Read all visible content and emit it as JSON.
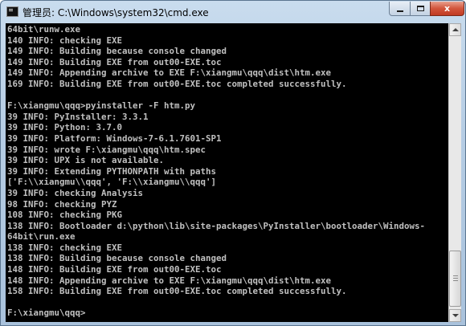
{
  "window": {
    "title": "管理员: C:\\Windows\\system32\\cmd.exe",
    "icon": "cmd-icon",
    "close_label": "x"
  },
  "console": {
    "lines": [
      "64bit\\runw.exe",
      "140 INFO: checking EXE",
      "149 INFO: Building because console changed",
      "149 INFO: Building EXE from out00-EXE.toc",
      "149 INFO: Appending archive to EXE F:\\xiangmu\\qqq\\dist\\htm.exe",
      "169 INFO: Building EXE from out00-EXE.toc completed successfully.",
      "",
      "F:\\xiangmu\\qqq>pyinstaller -F htm.py",
      "39 INFO: PyInstaller: 3.3.1",
      "39 INFO: Python: 3.7.0",
      "39 INFO: Platform: Windows-7-6.1.7601-SP1",
      "39 INFO: wrote F:\\xiangmu\\qqq\\htm.spec",
      "39 INFO: UPX is not available.",
      "39 INFO: Extending PYTHONPATH with paths",
      "['F:\\\\xiangmu\\\\qqq', 'F:\\\\xiangmu\\\\qqq']",
      "39 INFO: checking Analysis",
      "98 INFO: checking PYZ",
      "108 INFO: checking PKG",
      "138 INFO: Bootloader d:\\python\\lib\\site-packages\\PyInstaller\\bootloader\\Windows-",
      "64bit\\run.exe",
      "138 INFO: checking EXE",
      "138 INFO: Building because console changed",
      "148 INFO: Building EXE from out00-EXE.toc",
      "148 INFO: Appending archive to EXE F:\\xiangmu\\qqq\\dist\\htm.exe",
      "158 INFO: Building EXE from out00-EXE.toc completed successfully.",
      "",
      "F:\\xiangmu\\qqq>"
    ]
  },
  "colors": {
    "console_bg": "#000000",
    "console_text": "#c0c0c0",
    "close_button": "#c8452c"
  }
}
